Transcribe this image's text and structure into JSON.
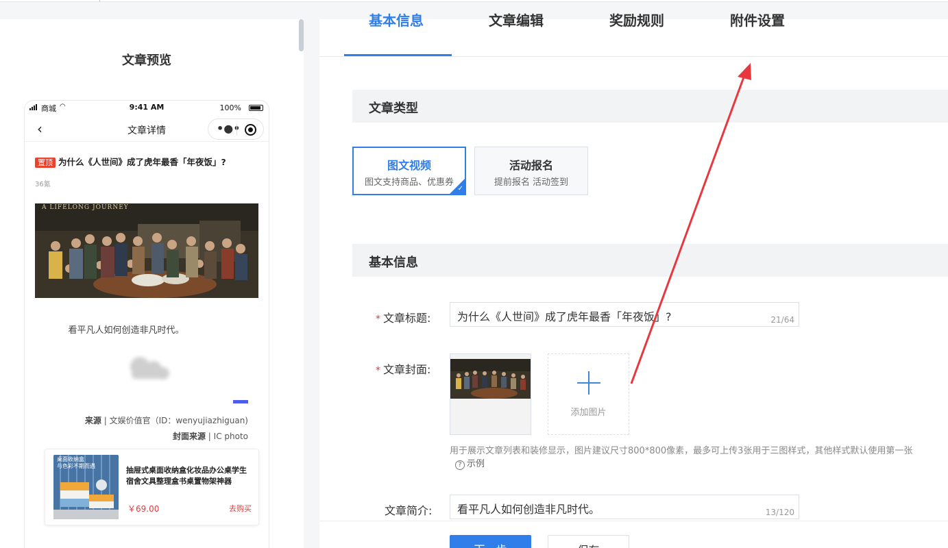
{
  "preview": {
    "title": "文章预览",
    "phone": {
      "carrier": "商城",
      "time": "9:41 AM",
      "battery": "100%",
      "nav_title": "文章详情",
      "back_icon": "chevron-left-icon",
      "more_icon": "more-dots-icon",
      "close_icon": "target-circle-icon"
    },
    "article": {
      "pin_badge": "置顶",
      "title": "为什么《人世间》成了虎年最香「年夜饭」?",
      "views": "36氪",
      "image_caption": "A LIFELONG JOURNEY",
      "summary": "看平凡人如何创造非凡时代。",
      "source_label": "来源",
      "source_value": " | 文娱价值官（ID：wenyujiazhiguan)",
      "cover_source_label": "封面来源",
      "cover_source_value": " | IC photo"
    },
    "product": {
      "image_text": "桌面收纳盒\n与色彩不期而遇",
      "name": "抽屉式桌面收纳盒化妆品办公桌学生宿舍文具整理盒书桌置物架神器",
      "price": "￥69.00",
      "buy_label": "去购买"
    }
  },
  "tabs": [
    {
      "label": "基本信息",
      "active": true
    },
    {
      "label": "文章编辑",
      "active": false
    },
    {
      "label": "奖励规则",
      "active": false
    },
    {
      "label": "附件设置",
      "active": false
    }
  ],
  "sections": {
    "type_title": "文章类型",
    "basic_title": "基本信息"
  },
  "article_types": [
    {
      "title": "图文视频",
      "subtitle": "图文支持商品、优惠券",
      "selected": true
    },
    {
      "title": "活动报名",
      "subtitle": "提前报名 活动签到",
      "selected": false
    }
  ],
  "form": {
    "title_label": "文章标题:",
    "title_value": "为什么《人世间》成了虎年最香「年夜饭」?",
    "title_counter": "21/64",
    "cover_label": "文章封面:",
    "add_image_label": "添加图片",
    "cover_hint": "用于展示文章列表和装修显示，图片建议尺寸800*800像素，最多可上传3张用于三图样式，其他样式默认使用第一张",
    "example_label": "示例",
    "summary_label": "文章简介:",
    "summary_value": "看平凡人如何创造非凡时代。",
    "summary_counter": "13/120"
  },
  "buttons": {
    "next": "下一步",
    "save": "保存"
  },
  "colors": {
    "accent": "#2f7ee9",
    "required": "#e4393c",
    "arrow": "#e8383d",
    "price": "#e4393c"
  }
}
